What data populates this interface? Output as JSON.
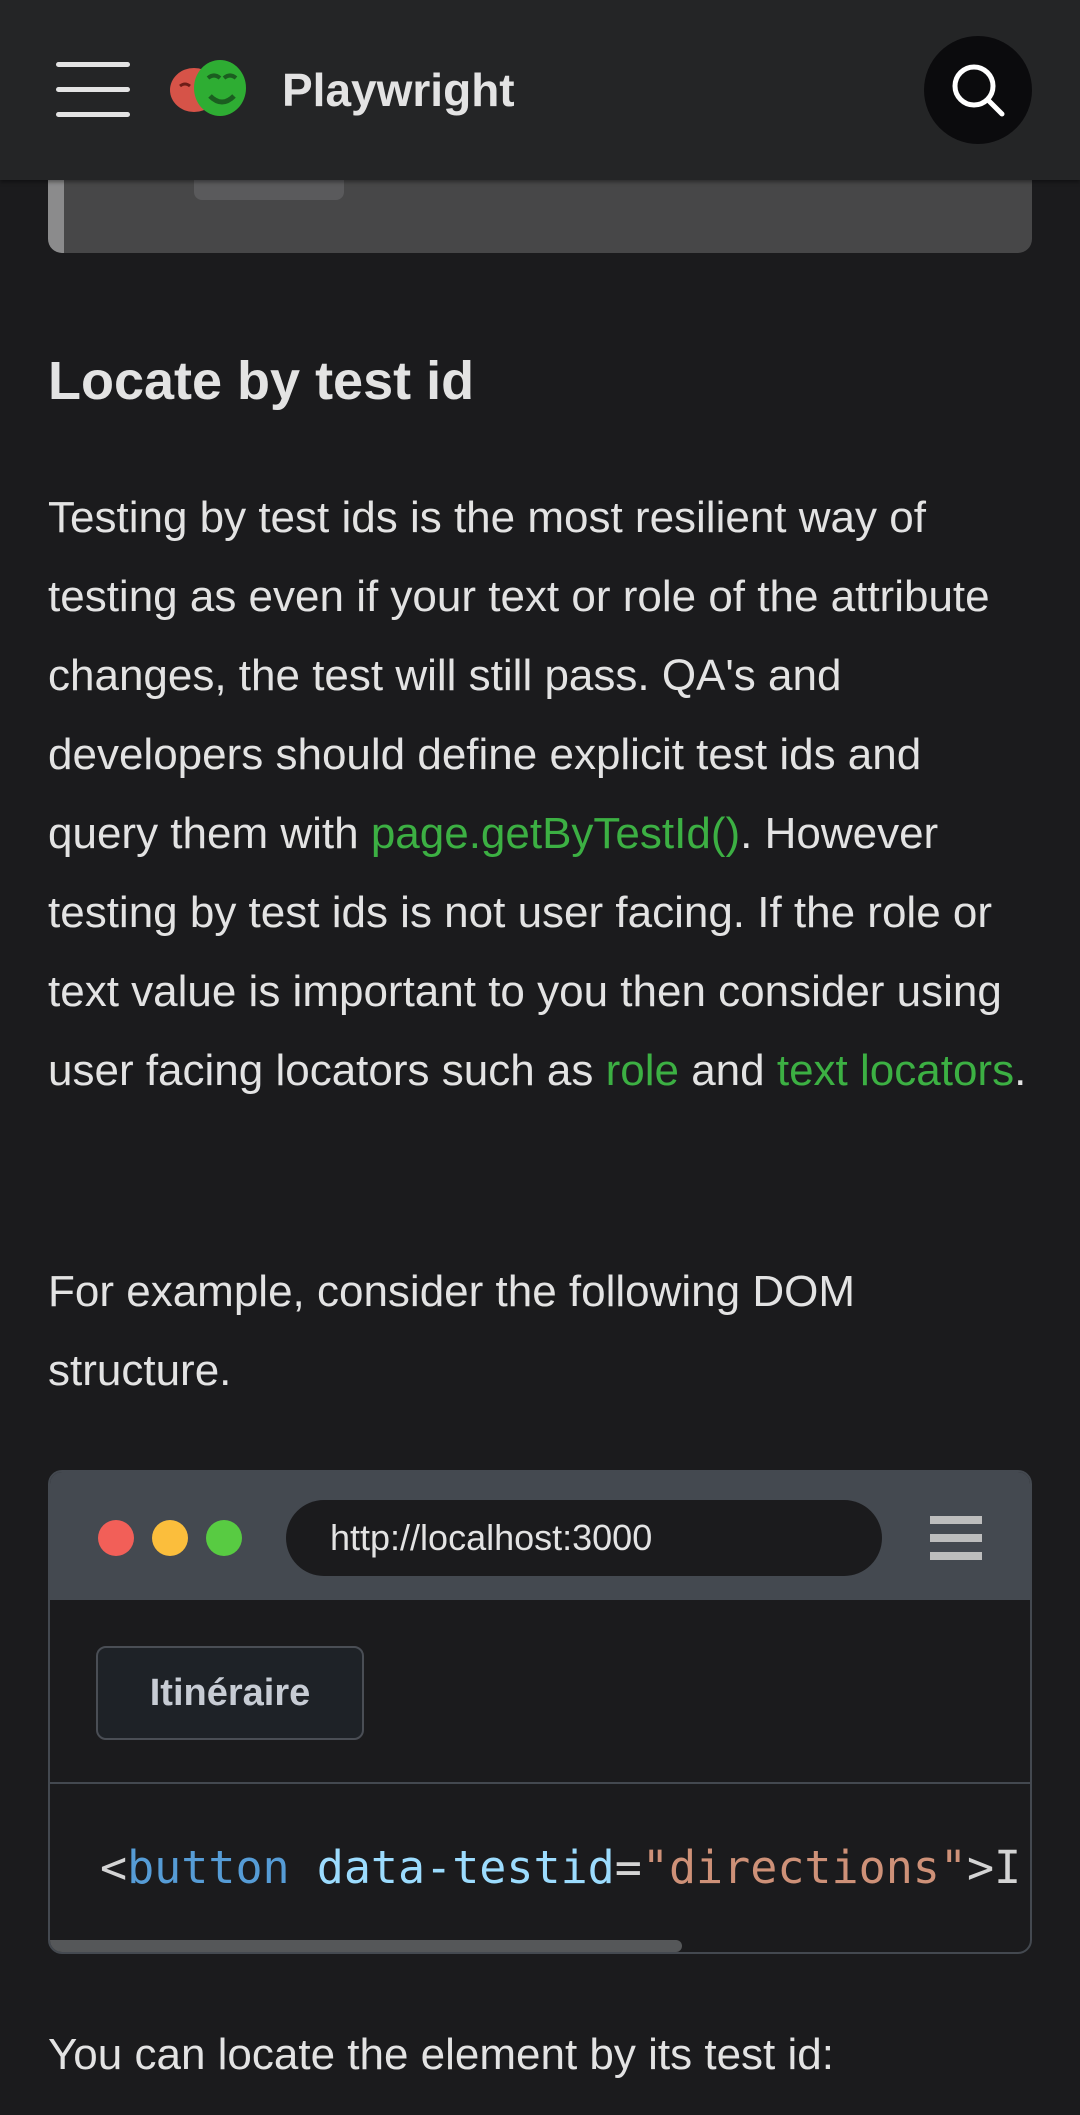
{
  "navbar": {
    "brand": "Playwright",
    "menu_icon": "hamburger-menu-icon",
    "search_icon": "search-icon"
  },
  "section": {
    "heading": "Locate by test id",
    "para1": {
      "t1": "Testing by test ids is the most resilient way of testing as even if your text or role of the attribute changes, the test will still pass. QA's and developers should define explicit test ids and query them with ",
      "link1": "page.getByTestId()",
      "t2": ". However testing by test ids is not user facing. If the role or text value is important to you then consider using user facing locators such as ",
      "link2": "role",
      "t3": " and ",
      "link3": "text locators",
      "t4": "."
    },
    "para2": "For example, consider the following DOM structure.",
    "para3": "You can locate the element by its test id:"
  },
  "browser_demo": {
    "url": "http://localhost:3000",
    "button_label": "Itinéraire",
    "code": {
      "open": "<",
      "tag": "button",
      "space": " ",
      "attr": "data-testid",
      "eq": "=",
      "value": "\"directions\"",
      "rest": ">I"
    }
  },
  "colors": {
    "background": "#1b1b1d",
    "navbar": "#242526",
    "link": "#3cb043",
    "dot_red": "#f25f58",
    "dot_yellow": "#fbbe3c",
    "dot_green": "#58cb42"
  }
}
